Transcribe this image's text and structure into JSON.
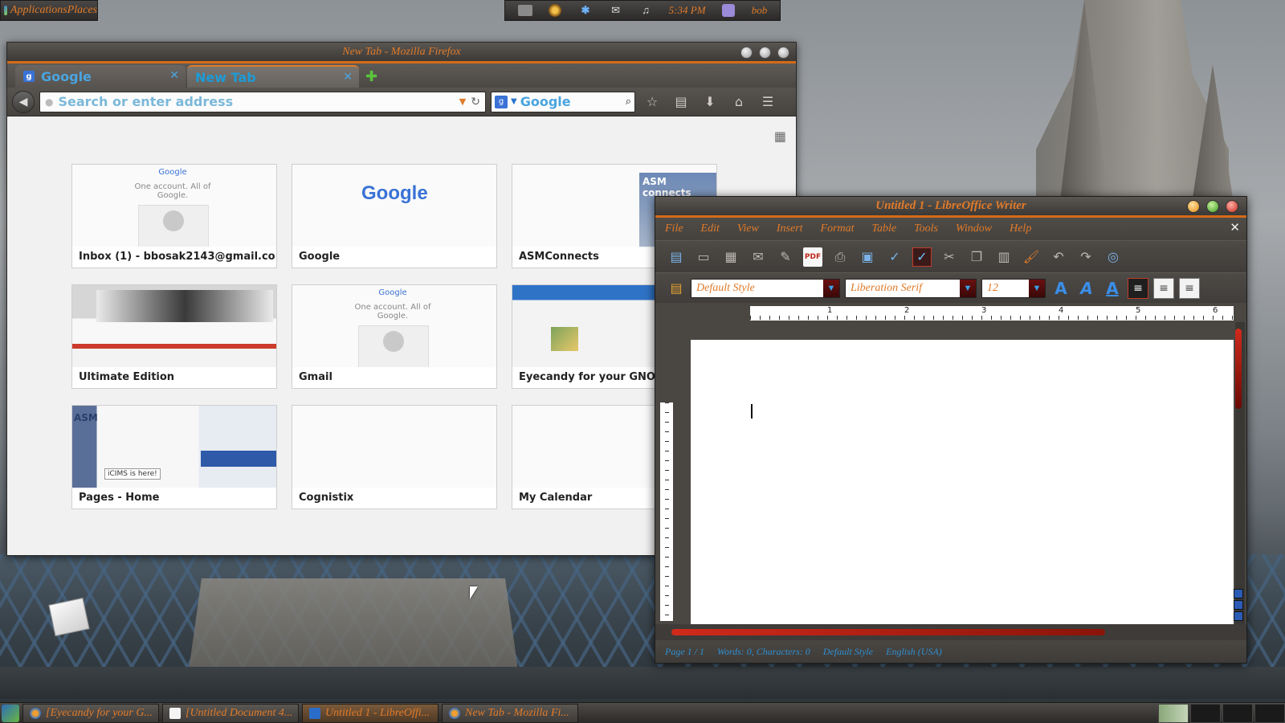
{
  "top_left_panel": {
    "label": "ApplicationsPlaces"
  },
  "top_panel": {
    "time": "5:34 PM",
    "user": "bob"
  },
  "firefox": {
    "window_title": "New Tab - Mozilla Firefox",
    "tabs": [
      {
        "label": "Google",
        "favicon": "g"
      },
      {
        "label": "New Tab"
      }
    ],
    "url_placeholder": "Search or enter address",
    "search_placeholder": "Google",
    "search_engine_icon": "g",
    "tiles": [
      {
        "title": "Inbox (1) - bbosak2143@gmail.co..."
      },
      {
        "title": "Google"
      },
      {
        "title": "ASMConnects"
      },
      {
        "title": "Ultimate Edition"
      },
      {
        "title": "Gmail"
      },
      {
        "title": "Eyecandy for your GNOME"
      },
      {
        "title": "Pages - Home"
      },
      {
        "title": "Cognistix"
      },
      {
        "title": "My Calendar"
      }
    ],
    "thumb_text": {
      "google_logo": "Google",
      "one_account": "One account. All of Google.",
      "asm": "ASM connects",
      "asm_short": "ASM",
      "icims": "iCIMS is here!"
    }
  },
  "writer": {
    "window_title": "Untitled 1 - LibreOffice Writer",
    "menu": [
      "File",
      "Edit",
      "View",
      "Insert",
      "Format",
      "Table",
      "Tools",
      "Window",
      "Help"
    ],
    "paragraph_style": "Default Style",
    "font_name": "Liberation Serif",
    "font_size": "12",
    "ruler_numbers": [
      "1",
      "2",
      "3",
      "4",
      "5",
      "6"
    ],
    "status": [
      "Page 1 / 1",
      "Words: 0, Characters: 0",
      "Default Style",
      "English (USA)"
    ]
  },
  "taskbar": {
    "items": [
      {
        "label": "[Eyecandy for your G...",
        "icon": "firefox-icon"
      },
      {
        "label": "[Untitled Document 4...",
        "icon": "document-icon"
      },
      {
        "label": "Untitled 1 - LibreOffi...",
        "icon": "writer-icon"
      },
      {
        "label": "New Tab - Mozilla Fi...",
        "icon": "firefox-icon"
      }
    ]
  },
  "colors": {
    "accent_orange": "#e07b2a",
    "firefox_blue": "#1e9bd7",
    "writer_red": "#d02a1b"
  }
}
